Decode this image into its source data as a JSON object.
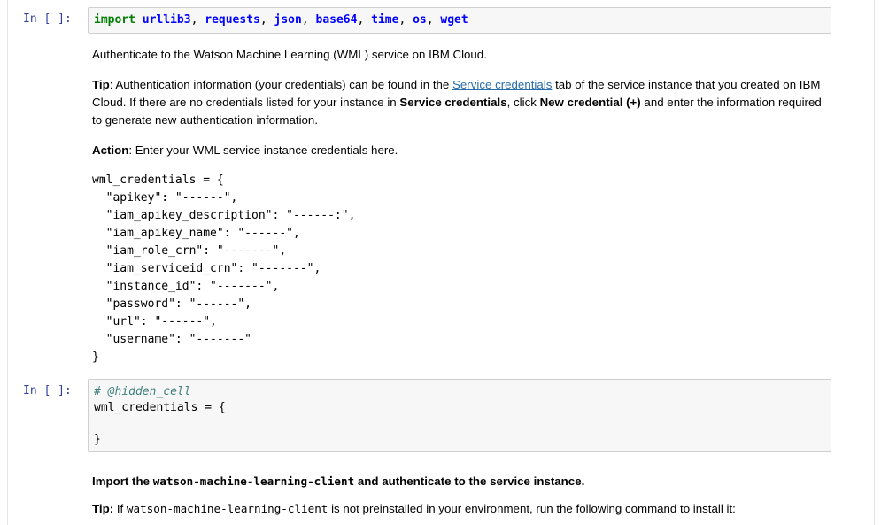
{
  "cells": {
    "cell1": {
      "prompt": "In [ ]:",
      "code": {
        "keyword": "import",
        "modules": [
          "urllib3",
          "requests",
          "json",
          "base64",
          "time",
          "os",
          "wget"
        ],
        "separator": ", "
      }
    },
    "md1": {
      "intro": "Authenticate to the Watson Machine Learning (WML) service on IBM Cloud.",
      "tip_label": "Tip",
      "tip_text_1": ": Authentication information (your credentials) can be found in the ",
      "tip_link": "Service credentials",
      "tip_text_2": " tab of the service instance that you created on IBM Cloud. If there are no credentials listed for your instance in ",
      "tip_bold_1": "Service credentials",
      "tip_text_3": ", click ",
      "tip_bold_2": "New credential (+)",
      "tip_text_4": " and enter the information required to generate new authentication information.",
      "action_label": "Action",
      "action_text": ": Enter your WML service instance credentials here.",
      "code_lines": [
        "wml_credentials = {",
        "  \"apikey\": \"------\",",
        "  \"iam_apikey_description\": \"------:\",",
        "  \"iam_apikey_name\": \"------\",",
        "  \"iam_role_crn\": \"-------\",",
        "  \"iam_serviceid_crn\": \"-------\",",
        "  \"instance_id\": \"-------\",",
        "  \"password\": \"------\",",
        "  \"url\": \"------\",",
        "  \"username\": \"-------\"",
        "}"
      ]
    },
    "cell2": {
      "prompt": "In [ ]:",
      "comment": "# @hidden_cell",
      "line2": "wml_credentials = {",
      "line3": "}"
    },
    "md2": {
      "heading_1": "Import the ",
      "heading_code": "watson-machine-learning-client",
      "heading_2": " and authenticate to the service instance.",
      "tip_label": "Tip:",
      "tip_text_1": " If ",
      "tip_code": "watson-machine-learning-client",
      "tip_text_2": " is not preinstalled in your environment, run the following command to install it:"
    }
  }
}
